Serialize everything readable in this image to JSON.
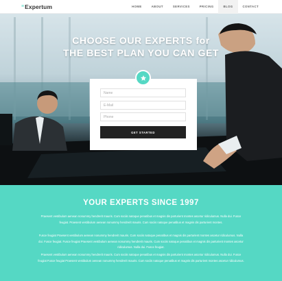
{
  "nav": {
    "logo_mark": "≡",
    "logo": "Expertum",
    "items": [
      "HOME",
      "ABOUT",
      "SERVICES",
      "PRICING",
      "BLOG",
      "CONTACT"
    ],
    "active_index": 4
  },
  "hero": {
    "title_line1": "CHOOSE OUR EXPERTS for",
    "title_line2": "THE BEST PLAN YOU CAN GET",
    "badge_icon": "star-icon"
  },
  "form": {
    "name_placeholder": "Name",
    "email_placeholder": "E-Mail",
    "phone_placeholder": "Phone",
    "submit_label": "GET STARTED"
  },
  "section": {
    "title": "YOUR EXPERTS SINCE 1997",
    "paragraphs": [
      "Praesent vestibulum aenean nonummy hendrerit mauris. Cum sociis natoque penatibus et magnis dis parturient montes ascetur ridiculumus. Nulla dui. Fusce feugiat. Praesent vestibulum aenean nonummy hendrerit mauris. Cum sociis natoque penatibus et magnis dis parturient montes.",
      "Fusce feugiat Praesent vestibulum aenean nonummy hendrerit mauris. Cum sociis natoque penatibus et magnis dis parturient montes ascetur ridiculumus. Nulla dui. Fusce feugiat. Fusce feugiat Praesent vestibulum aenean nonummy hendrerit mauris. Cum sociis natoque penatibus et magnis dis parturient montes ascetur ridiculumus. Nulla dui. Fusce feugiat.",
      "Praesent vestibulum aenean nonummy hendrerit mauris. Cum sociis natoque penatibus et magnis dis parturient montes ascetur ridiculumus. Nulla dui. Fusce feugiat Fusce feugiat Praesent vestibulum aenean nonummy hendrerit mauris. Cum sociis natoque penatibus et magnis dis parturient montes ascetur ridiculumus."
    ]
  },
  "colors": {
    "accent": "#55d8c4",
    "button": "#222222"
  }
}
